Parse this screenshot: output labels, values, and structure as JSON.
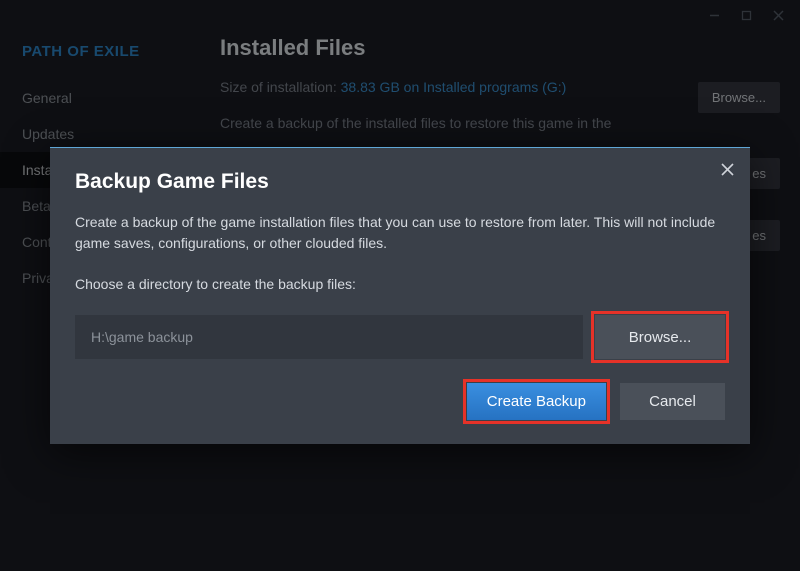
{
  "window": {
    "game_title": "PATH OF EXILE"
  },
  "sidebar": {
    "items": [
      {
        "label": "General"
      },
      {
        "label": "Updates"
      },
      {
        "label": "Installed Files"
      },
      {
        "label": "Betas"
      },
      {
        "label": "Controller"
      },
      {
        "label": "Privacy"
      }
    ]
  },
  "main": {
    "heading": "Installed Files",
    "size_label": "Size of installation: ",
    "size_value": "38.83 GB on Installed programs (G:)",
    "browse_label": "Browse...",
    "files_suffix": "es",
    "backup_hint": "Create a backup of the installed files to restore this game in the"
  },
  "modal": {
    "title": "Backup Game Files",
    "description": "Create a backup of the game installation files that you can use to restore from later. This will not include game saves, configurations, or other clouded files.",
    "choose_label": "Choose a directory to create the backup files:",
    "path_value": "H:\\game backup",
    "browse_label": "Browse...",
    "create_label": "Create Backup",
    "cancel_label": "Cancel"
  }
}
